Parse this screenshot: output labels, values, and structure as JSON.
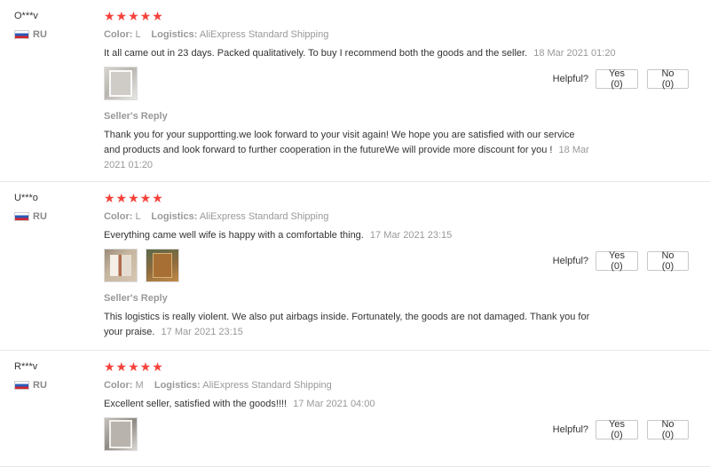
{
  "labels": {
    "helpful": "Helpful?",
    "color": "Color:",
    "logistics": "Logistics:",
    "sellers_reply": "Seller's Reply"
  },
  "reviews": [
    {
      "user": "O***v",
      "country": "RU",
      "stars": "★★★★★",
      "color": "L",
      "logistics": "AliExpress Standard Shipping",
      "text": "It all came out in 23 days. Packed qualitatively. To buy I recommend both the goods and the seller.",
      "date": "18 Mar 2021 01:20",
      "yes": "Yes (0)",
      "no": "No (0)",
      "reply_text": "Thank you for your supportting.we look forward to your visit again! We hope you are satisfied with our service and products and look forward to further cooperation in the futureWe will provide more discount for you !",
      "reply_date": "18 Mar 2021 01:20"
    },
    {
      "user": "U***o",
      "country": "RU",
      "stars": "★★★★★",
      "color": "L",
      "logistics": "AliExpress Standard Shipping",
      "text": "Everything came well wife is happy with a comfortable thing.",
      "date": "17 Mar 2021 23:15",
      "yes": "Yes (0)",
      "no": "No (0)",
      "reply_text": "This logistics is really violent. We also put airbags inside. Fortunately, the goods are not damaged. Thank you for your praise.",
      "reply_date": "17 Mar 2021 23:15"
    },
    {
      "user": "R***v",
      "country": "RU",
      "stars": "★★★★★",
      "color": "M",
      "logistics": "AliExpress Standard Shipping",
      "text": "Excellent seller, satisfied with the goods!!!!",
      "date": "17 Mar 2021 04:00",
      "yes": "Yes (0)",
      "no": "No (0)"
    }
  ]
}
